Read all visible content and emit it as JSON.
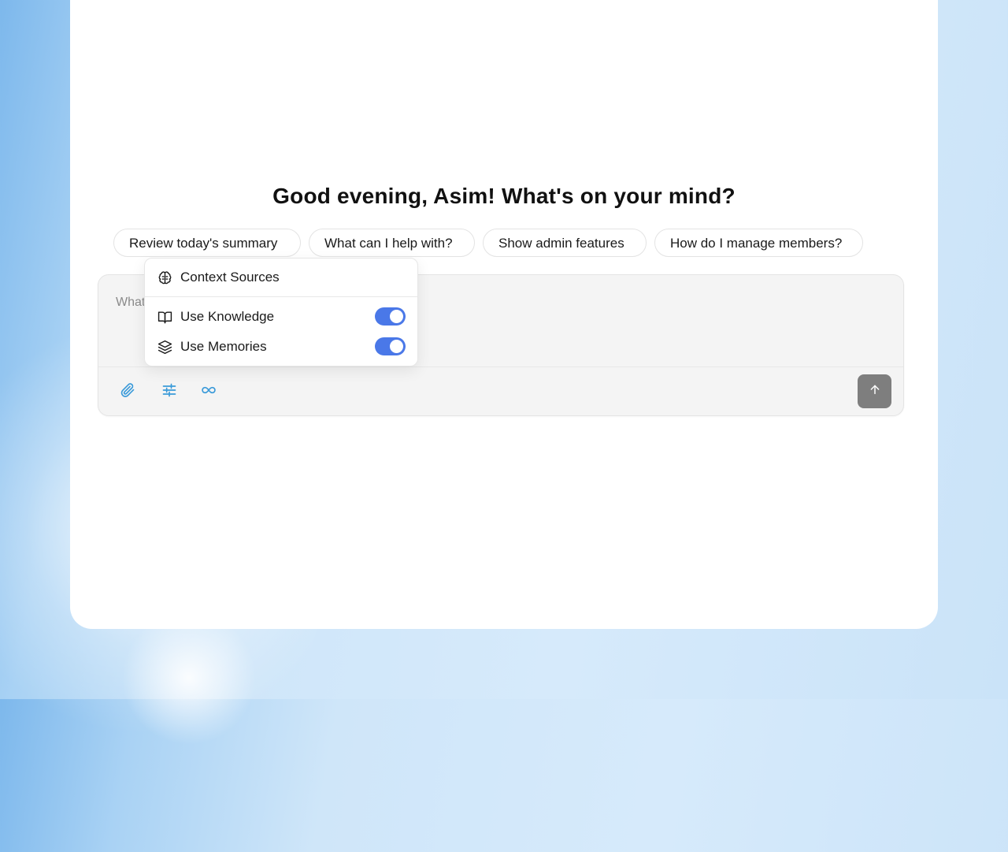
{
  "greeting": "Good evening, Asim! What's on your mind?",
  "suggestions": [
    "Review today's summary",
    "What can I help with?",
    "Show admin features",
    "How do I manage members?"
  ],
  "composer": {
    "placeholder": "What",
    "tools": [
      "paperclip-icon",
      "sliders-icon",
      "infinity-icon"
    ],
    "send_icon": "arrow-up-icon"
  },
  "context_popover": {
    "title": "Context Sources",
    "title_icon": "brain-icon",
    "options": [
      {
        "label": "Use Knowledge",
        "icon": "book-icon",
        "enabled": true
      },
      {
        "label": "Use Memories",
        "icon": "layers-icon",
        "enabled": true
      }
    ]
  },
  "colors": {
    "accent": "#4a78e8",
    "tool_icon": "#3a9ad9",
    "send_button": "#7e7e7e"
  }
}
